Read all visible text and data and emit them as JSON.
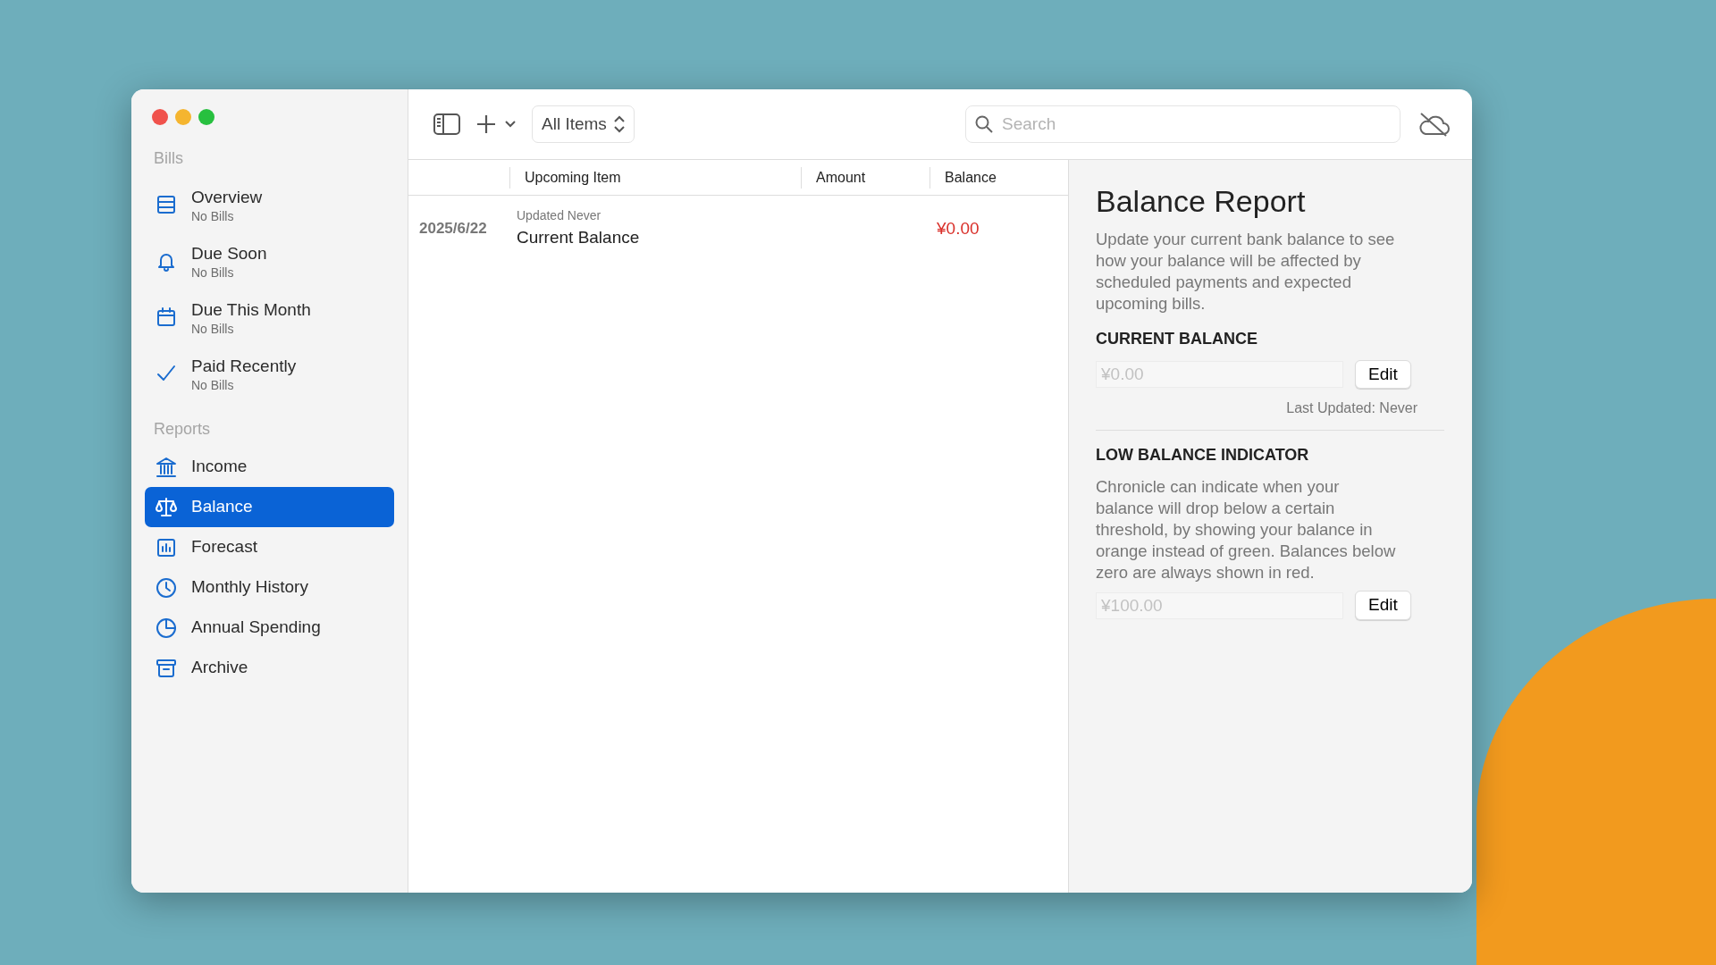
{
  "sidebar": {
    "sections": [
      {
        "title": "Bills",
        "items": [
          {
            "label": "Overview",
            "subtitle": "No Bills",
            "selected": false
          },
          {
            "label": "Due Soon",
            "subtitle": "No Bills",
            "selected": false
          },
          {
            "label": "Due This Month",
            "subtitle": "No Bills",
            "selected": false
          },
          {
            "label": "Paid Recently",
            "subtitle": "No Bills",
            "selected": false
          }
        ]
      },
      {
        "title": "Reports",
        "items": [
          {
            "label": "Income",
            "selected": false
          },
          {
            "label": "Balance",
            "selected": true
          },
          {
            "label": "Forecast",
            "selected": false
          },
          {
            "label": "Monthly History",
            "selected": false
          },
          {
            "label": "Annual Spending",
            "selected": false
          },
          {
            "label": "Archive",
            "selected": false
          }
        ]
      }
    ]
  },
  "toolbar": {
    "filter": "All Items",
    "search": {
      "placeholder": "Search"
    }
  },
  "table": {
    "columns": [
      "Upcoming Item",
      "Amount",
      "Balance"
    ],
    "rows": [
      {
        "date": "2025/6/22",
        "note": "Updated Never",
        "item": "Current Balance",
        "balance": "¥0.00"
      }
    ]
  },
  "report": {
    "title": "Balance Report",
    "intro": "Update your current bank balance to see how your balance will be affected by scheduled payments and expected upcoming bills.",
    "sections": [
      {
        "heading": "CURRENT BALANCE",
        "field": {
          "placeholder": "¥0.00"
        },
        "button": "Edit",
        "note": "Last Updated: Never"
      },
      {
        "heading": "LOW BALANCE INDICATOR",
        "description": "Chronicle can indicate when your balance will drop below a certain threshold, by showing your balance in orange instead of green. Balances below zero are always shown in red.",
        "field": {
          "placeholder": "¥100.00"
        },
        "button": "Edit"
      }
    ]
  }
}
